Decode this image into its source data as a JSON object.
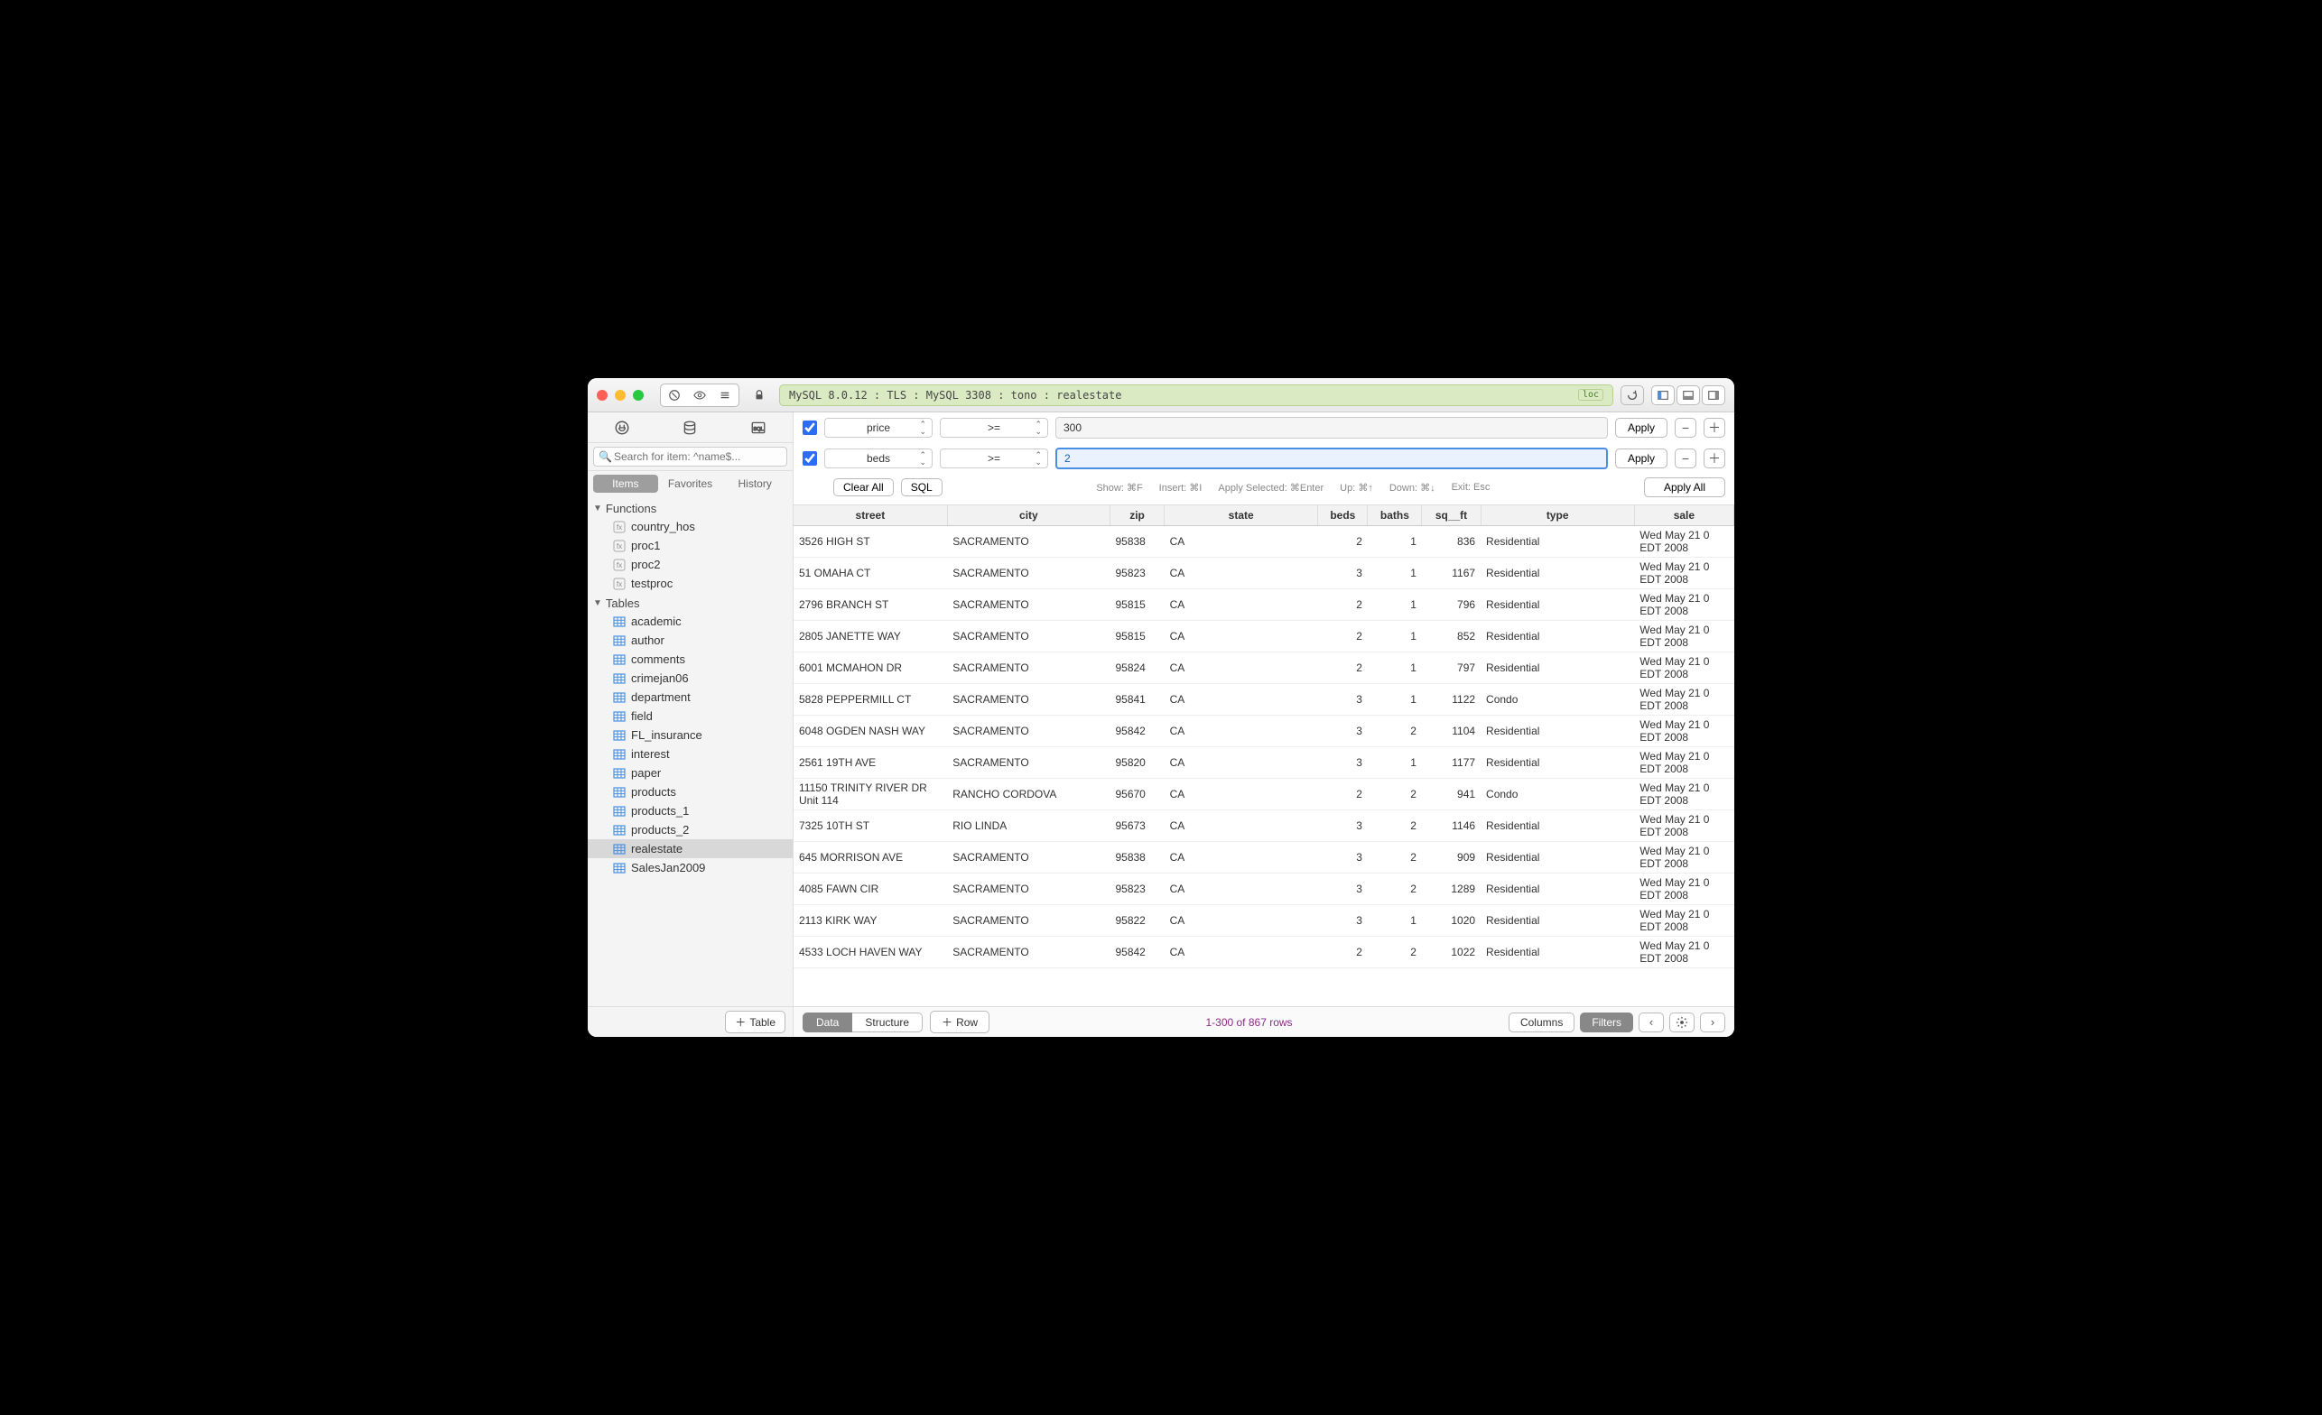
{
  "titlebar": {
    "connection_string": "MySQL 8.0.12 : TLS : MySQL 3308 : tono : realestate",
    "loc_badge": "loc"
  },
  "sidebar": {
    "search_placeholder": "Search for item: ^name$...",
    "tabs": {
      "items": "Items",
      "favorites": "Favorites",
      "history": "History"
    },
    "sections": {
      "functions": {
        "label": "Functions",
        "items": [
          "country_hos",
          "proc1",
          "proc2",
          "testproc"
        ]
      },
      "tables": {
        "label": "Tables",
        "items": [
          "academic",
          "author",
          "comments",
          "crimejan06",
          "department",
          "field",
          "FL_insurance",
          "interest",
          "paper",
          "products",
          "products_1",
          "products_2",
          "realestate",
          "SalesJan2009"
        ],
        "selected": "realestate"
      }
    },
    "add_table_label": "Table"
  },
  "filters": {
    "rows": [
      {
        "enabled": true,
        "column": "price",
        "op": ">=",
        "value": "300"
      },
      {
        "enabled": true,
        "column": "beds",
        "op": ">=",
        "value": "2"
      }
    ],
    "clear_all": "Clear All",
    "sql": "SQL",
    "hints": {
      "show": "Show: ⌘F",
      "insert": "Insert: ⌘I",
      "apply_selected": "Apply Selected: ⌘Enter",
      "up": "Up: ⌘↑",
      "down": "Down: ⌘↓",
      "exit": "Exit: Esc"
    },
    "apply": "Apply",
    "apply_all": "Apply All"
  },
  "grid": {
    "columns": [
      "street",
      "city",
      "zip",
      "state",
      "beds",
      "baths",
      "sq__ft",
      "type",
      "sale"
    ],
    "rows": [
      {
        "street": "3526 HIGH ST",
        "city": "SACRAMENTO",
        "zip": "95838",
        "state": "CA",
        "beds": 2,
        "baths": 1,
        "sq__ft": 836,
        "type": "Residential",
        "sale": "Wed May 21 0 EDT 2008"
      },
      {
        "street": "51 OMAHA CT",
        "city": "SACRAMENTO",
        "zip": "95823",
        "state": "CA",
        "beds": 3,
        "baths": 1,
        "sq__ft": 1167,
        "type": "Residential",
        "sale": "Wed May 21 0 EDT 2008"
      },
      {
        "street": "2796 BRANCH ST",
        "city": "SACRAMENTO",
        "zip": "95815",
        "state": "CA",
        "beds": 2,
        "baths": 1,
        "sq__ft": 796,
        "type": "Residential",
        "sale": "Wed May 21 0 EDT 2008"
      },
      {
        "street": "2805 JANETTE WAY",
        "city": "SACRAMENTO",
        "zip": "95815",
        "state": "CA",
        "beds": 2,
        "baths": 1,
        "sq__ft": 852,
        "type": "Residential",
        "sale": "Wed May 21 0 EDT 2008"
      },
      {
        "street": "6001 MCMAHON DR",
        "city": "SACRAMENTO",
        "zip": "95824",
        "state": "CA",
        "beds": 2,
        "baths": 1,
        "sq__ft": 797,
        "type": "Residential",
        "sale": "Wed May 21 0 EDT 2008"
      },
      {
        "street": "5828 PEPPERMILL CT",
        "city": "SACRAMENTO",
        "zip": "95841",
        "state": "CA",
        "beds": 3,
        "baths": 1,
        "sq__ft": 1122,
        "type": "Condo",
        "sale": "Wed May 21 0 EDT 2008"
      },
      {
        "street": "6048 OGDEN NASH WAY",
        "city": "SACRAMENTO",
        "zip": "95842",
        "state": "CA",
        "beds": 3,
        "baths": 2,
        "sq__ft": 1104,
        "type": "Residential",
        "sale": "Wed May 21 0 EDT 2008"
      },
      {
        "street": "2561 19TH AVE",
        "city": "SACRAMENTO",
        "zip": "95820",
        "state": "CA",
        "beds": 3,
        "baths": 1,
        "sq__ft": 1177,
        "type": "Residential",
        "sale": "Wed May 21 0 EDT 2008"
      },
      {
        "street": "11150 TRINITY RIVER DR Unit 114",
        "city": "RANCHO CORDOVA",
        "zip": "95670",
        "state": "CA",
        "beds": 2,
        "baths": 2,
        "sq__ft": 941,
        "type": "Condo",
        "sale": "Wed May 21 0 EDT 2008"
      },
      {
        "street": "7325 10TH ST",
        "city": "RIO LINDA",
        "zip": "95673",
        "state": "CA",
        "beds": 3,
        "baths": 2,
        "sq__ft": 1146,
        "type": "Residential",
        "sale": "Wed May 21 0 EDT 2008"
      },
      {
        "street": "645 MORRISON AVE",
        "city": "SACRAMENTO",
        "zip": "95838",
        "state": "CA",
        "beds": 3,
        "baths": 2,
        "sq__ft": 909,
        "type": "Residential",
        "sale": "Wed May 21 0 EDT 2008"
      },
      {
        "street": "4085 FAWN CIR",
        "city": "SACRAMENTO",
        "zip": "95823",
        "state": "CA",
        "beds": 3,
        "baths": 2,
        "sq__ft": 1289,
        "type": "Residential",
        "sale": "Wed May 21 0 EDT 2008"
      },
      {
        "street": "2113 KIRK WAY",
        "city": "SACRAMENTO",
        "zip": "95822",
        "state": "CA",
        "beds": 3,
        "baths": 1,
        "sq__ft": 1020,
        "type": "Residential",
        "sale": "Wed May 21 0 EDT 2008"
      },
      {
        "street": "4533 LOCH HAVEN WAY",
        "city": "SACRAMENTO",
        "zip": "95842",
        "state": "CA",
        "beds": 2,
        "baths": 2,
        "sq__ft": 1022,
        "type": "Residential",
        "sale": "Wed May 21 0 EDT 2008"
      }
    ]
  },
  "footer": {
    "data": "Data",
    "structure": "Structure",
    "row": "Row",
    "rowcount": "1-300 of 867 rows",
    "columns": "Columns",
    "filters": "Filters"
  }
}
